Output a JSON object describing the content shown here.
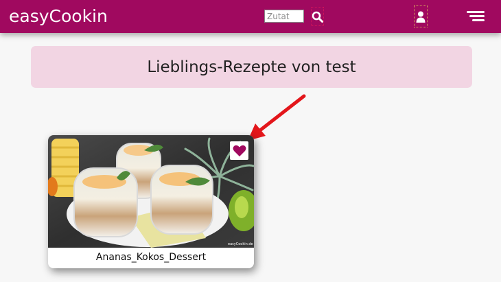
{
  "header": {
    "brand": "easyCookin",
    "search_placeholder": "Zutat",
    "search_icon": "search-icon",
    "user_icon": "user-icon",
    "menu_icon": "hamburger-menu-icon"
  },
  "main": {
    "title": "Lieblings-Rezepte von test"
  },
  "recipes": [
    {
      "name": "Ananas_Kokos_Dessert",
      "favorite_icon": "heart-icon",
      "favorite": true,
      "image_watermark": "easyCookin.de"
    }
  ],
  "colors": {
    "brand": "#a0095f",
    "title_background": "#f2d5e3",
    "arrow": "#e3161b",
    "page_background": "#f7f7f7"
  }
}
